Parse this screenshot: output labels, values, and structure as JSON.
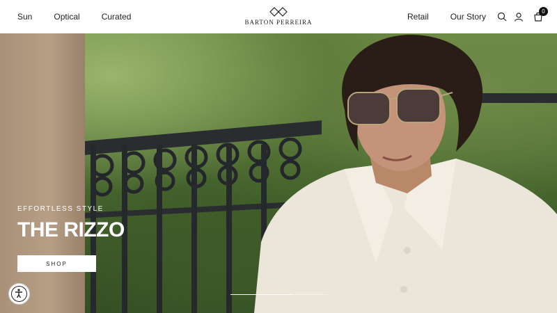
{
  "nav": {
    "left": [
      "Sun",
      "Optical",
      "Curated"
    ],
    "right": [
      "Retail",
      "Our Story"
    ]
  },
  "logo": {
    "text": "BARTON PERREIRA"
  },
  "icons": {
    "search": "search-icon",
    "account": "account-icon",
    "cart": "cart-icon",
    "cart_count": "0"
  },
  "hero": {
    "eyebrow": "EFFORTLESS STYLE",
    "headline": "THE RIZZO",
    "cta": "SHOP",
    "slide_progress": 0.65
  },
  "accessibility": {
    "icon": "accessibility-icon"
  }
}
